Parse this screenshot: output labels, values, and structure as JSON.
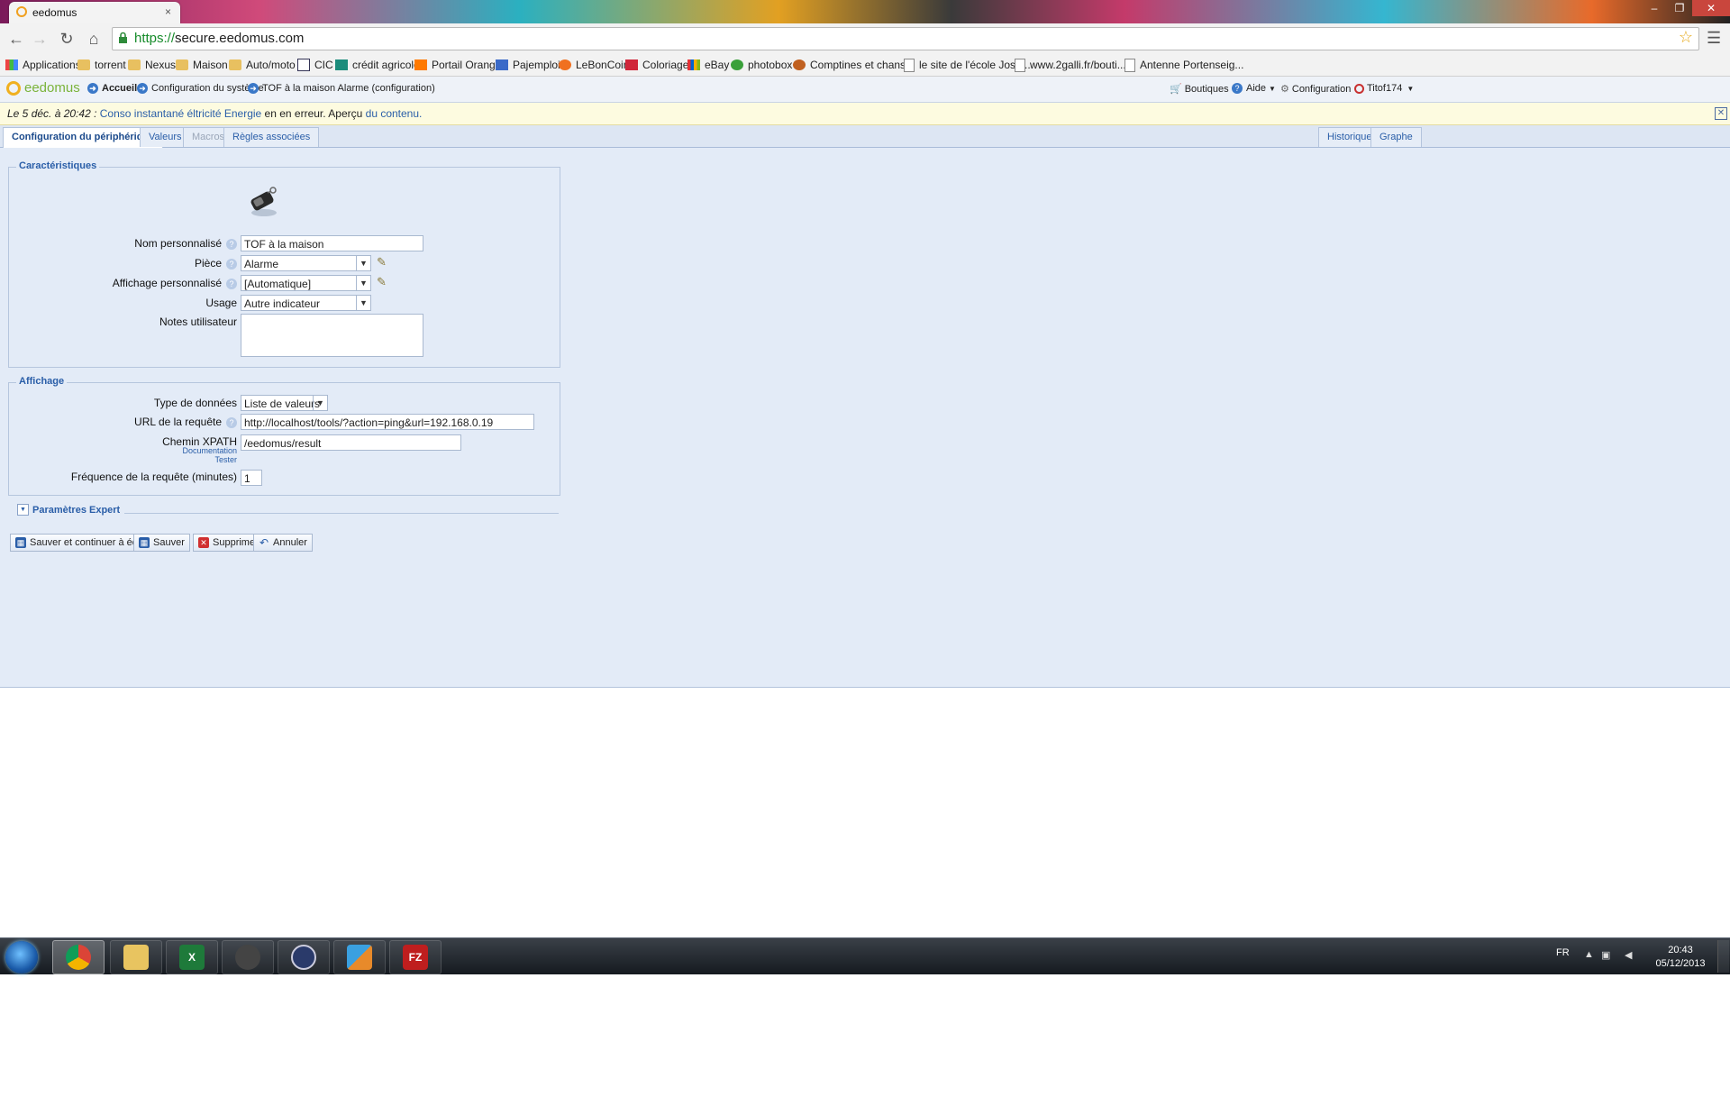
{
  "browser": {
    "tab_title": "eedomus",
    "tab_close": "×",
    "win_minimize": "–",
    "win_restore": "❐",
    "win_close": "✕",
    "url_scheme": "https://",
    "url_rest": "secure.eedomus.com"
  },
  "bookmarks": [
    {
      "label": "Applications",
      "icon": "apps-icon"
    },
    {
      "label": "torrent",
      "icon": "folder-icon"
    },
    {
      "label": "Nexus",
      "icon": "folder-icon"
    },
    {
      "label": "Maison",
      "icon": "folder-icon"
    },
    {
      "label": "Auto/moto",
      "icon": "folder-icon"
    },
    {
      "label": "CIC",
      "icon": "cic-icon"
    },
    {
      "label": "crédit agricole",
      "icon": "ca-icon"
    },
    {
      "label": "Portail Orange",
      "icon": "orange-icon"
    },
    {
      "label": "Pajemploi",
      "icon": "pajemploi-icon"
    },
    {
      "label": "LeBonCoin",
      "icon": "leboncoin-icon"
    },
    {
      "label": "Coloriage",
      "icon": "coloriage-icon"
    },
    {
      "label": "eBay",
      "icon": "ebay-icon"
    },
    {
      "label": "photobox",
      "icon": "photobox-icon"
    },
    {
      "label": "Comptines et chans...",
      "icon": "comptines-icon"
    },
    {
      "label": "le site de l'école Jose...",
      "icon": "page-icon"
    },
    {
      "label": "www.2galli.fr/bouti...",
      "icon": "page-icon"
    },
    {
      "label": "Antenne Portenseig...",
      "icon": "page-icon"
    }
  ],
  "appnav": {
    "logo": "eedomus",
    "home": "Accueil",
    "system_config": "Configuration du système",
    "device": "TOF à la maison Alarme (configuration)",
    "shops": "Boutiques",
    "help": "Aide",
    "configuration": "Configuration",
    "user": "Titof174"
  },
  "notification": {
    "date": "Le 5 déc. à 20:42 :",
    "device_link": "Conso instantané éltricité Energie",
    "message": "en en erreur. Aperçu",
    "content_link": "du contenu."
  },
  "tabs": {
    "device_config": "Configuration du périphérique",
    "values": "Valeurs",
    "macros": "Macros",
    "rules": "Règles associées",
    "history": "Historique",
    "graph": "Graphe"
  },
  "characteristics": {
    "legend": "Caractéristiques",
    "name_label": "Nom personnalisé",
    "name_value": "TOF à la maison",
    "room_label": "Pièce",
    "room_value": "Alarme",
    "display_label": "Affichage personnalisé",
    "display_value": "[Automatique]",
    "usage_label": "Usage",
    "usage_value": "Autre indicateur",
    "notes_label": "Notes utilisateur",
    "notes_value": ""
  },
  "display": {
    "legend": "Affichage",
    "datatype_label": "Type de données",
    "datatype_value": "Liste de valeurs",
    "url_label": "URL de la requête",
    "url_value": "http://localhost/tools/?action=ping&url=192.168.0.19",
    "xpath_label": "Chemin XPATH",
    "xpath_value": "/eedomus/result",
    "doc_link": "Documentation",
    "test_link": "Tester",
    "freq_label": "Fréquence de la requête (minutes)",
    "freq_value": "1"
  },
  "expert": {
    "label": "Paramètres Expert"
  },
  "buttons": {
    "save_continue": "Sauver et continuer à éditer",
    "save": "Sauver",
    "delete": "Supprimer",
    "cancel": "Annuler"
  },
  "taskbar": {
    "lang": "FR",
    "time": "20:43",
    "date": "05/12/2013"
  },
  "colors": {
    "panel_bg": "#e3ebf7",
    "legend_blue": "#2a5ea8",
    "notification_bg": "#fdfbe0"
  }
}
